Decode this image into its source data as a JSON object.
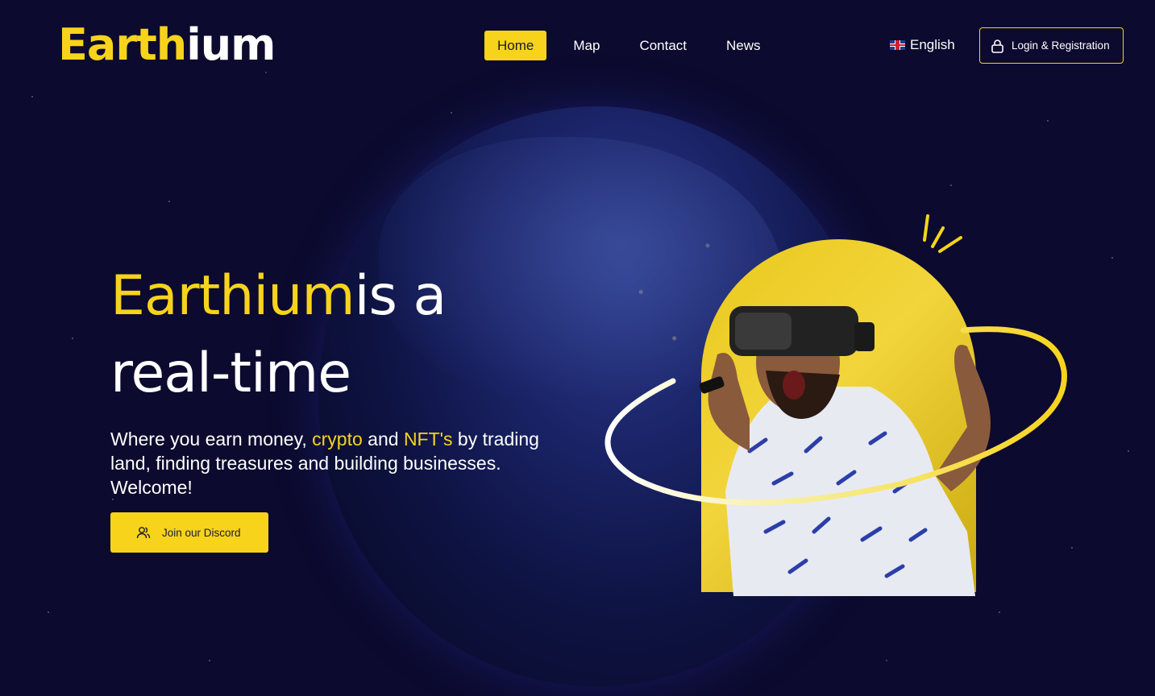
{
  "brand": {
    "logo_part1": "Earth",
    "logo_part2": "ium"
  },
  "nav": {
    "items": [
      {
        "label": "Home",
        "active": true
      },
      {
        "label": "Map",
        "active": false
      },
      {
        "label": "Contact",
        "active": false
      },
      {
        "label": "News",
        "active": false
      }
    ]
  },
  "language": {
    "label": "English",
    "flag_icon": "uk-flag-icon"
  },
  "login": {
    "label": "Login & Registration",
    "icon": "lock-icon"
  },
  "hero": {
    "title_highlight": "Earthium",
    "title_rest_line1": "is a",
    "title_line2": "real-time",
    "desc_part1": "Where you earn money, ",
    "desc_crypto": "crypto",
    "desc_and": " and ",
    "desc_nft": "NFT's",
    "desc_part2": " by trading land, finding treasures and building businesses. Welcome!",
    "discord_label": "Join our Discord",
    "discord_icon": "users-icon"
  },
  "colors": {
    "accent": "#f7d31c",
    "background": "#0c0a2e"
  }
}
